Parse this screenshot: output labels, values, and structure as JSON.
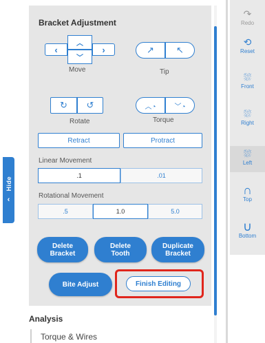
{
  "hide_tab": {
    "label": "Hide",
    "chevron": "‹"
  },
  "bracket": {
    "title": "Bracket Adjustment",
    "move_label": "Move",
    "tip_label": "Tip",
    "rotate_label": "Rotate",
    "torque_label": "Torque",
    "retract": "Retract",
    "protract": "Protract",
    "linear_label": "Linear Movement",
    "linear_options": [
      ".1",
      ".01"
    ],
    "rotational_label": "Rotational Movement",
    "rotational_options": [
      ".5",
      "1.0",
      "5.0"
    ],
    "delete_bracket": "Delete Bracket",
    "delete_tooth": "Delete Tooth",
    "duplicate_bracket": "Duplicate Bracket",
    "bite_adjust": "Bite Adjust",
    "finish_editing": "Finish Editing"
  },
  "analysis": {
    "title": "Analysis",
    "item": "Torque & Wires"
  },
  "rail": {
    "redo": "Redo",
    "reset": "Reset",
    "front": "Front",
    "right": "Right",
    "left": "Left",
    "top": "Top",
    "bottom": "Bottom"
  },
  "colors": {
    "accent": "#2f7fd0",
    "highlight": "#e0261c",
    "panel": "#e6e6e6"
  }
}
